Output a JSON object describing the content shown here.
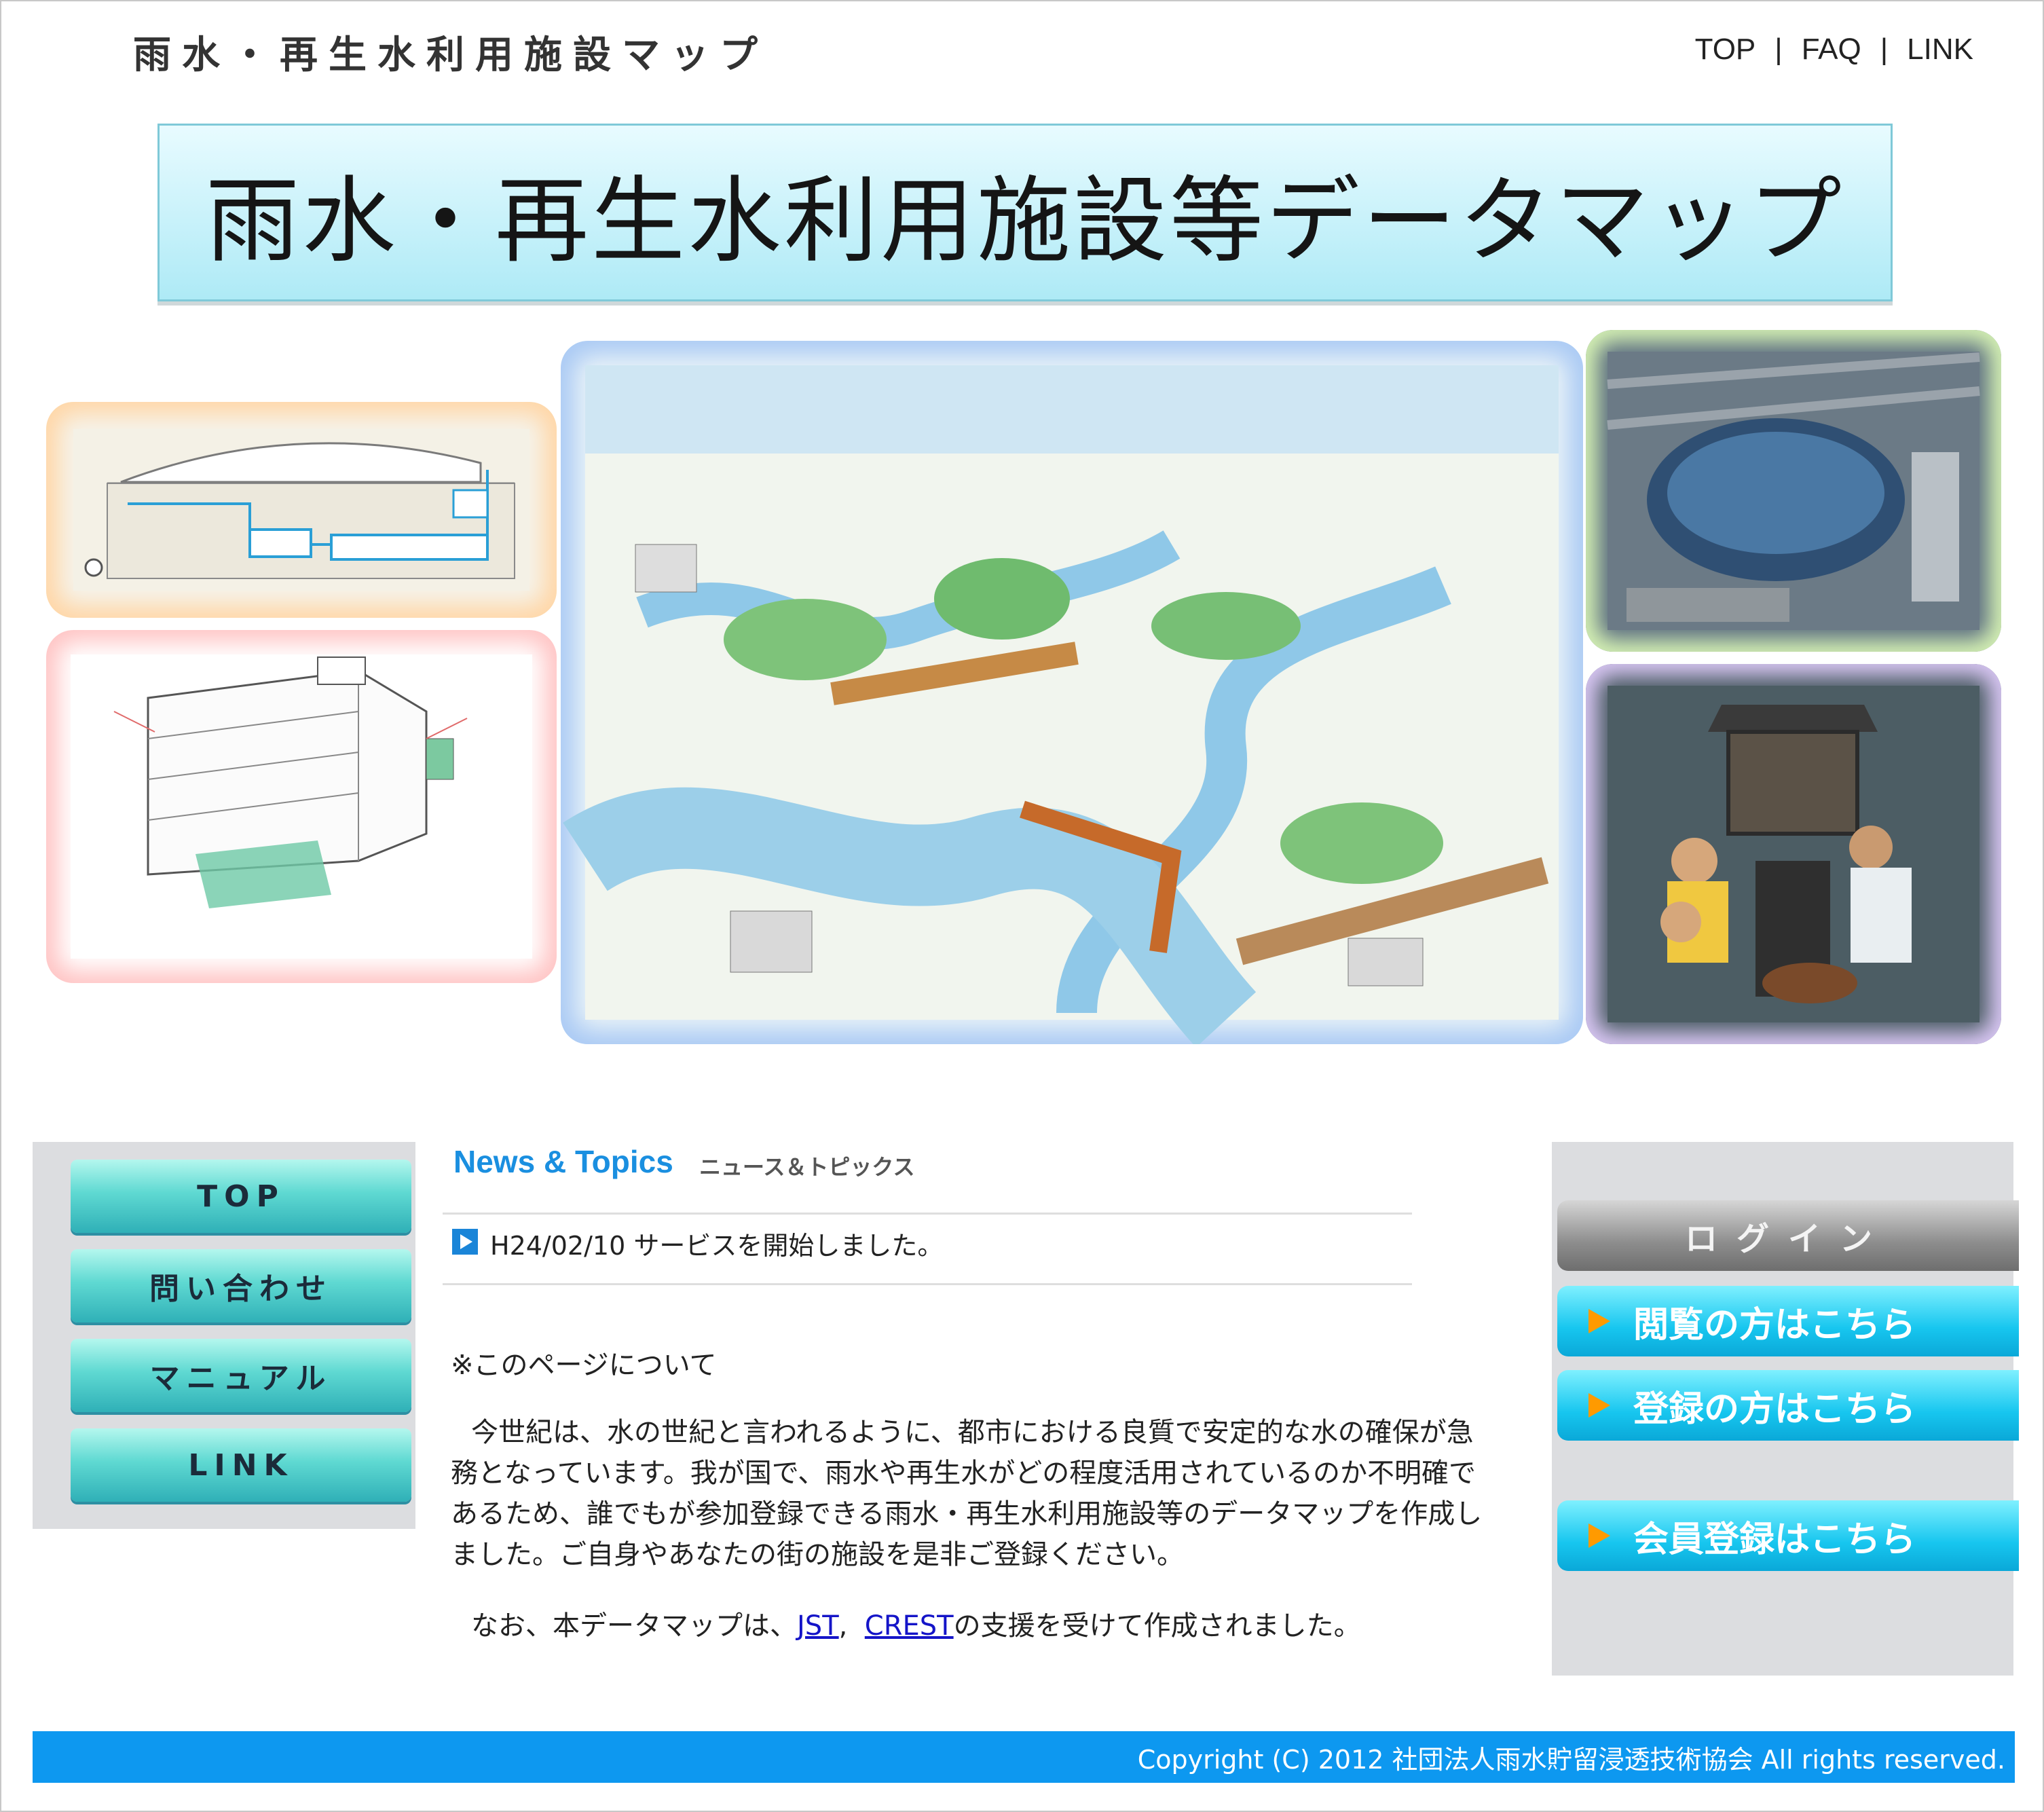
{
  "header": {
    "site_title": "雨水・再生水利用施設マップ",
    "nav": [
      "TOP",
      "FAQ",
      "LINK"
    ]
  },
  "banner": {
    "title": "雨水・再生水利用施設等データマップ"
  },
  "hero": {
    "images": [
      "facility-section-diagram",
      "building-diagram",
      "water-cycle-city-illustration",
      "stadium-aerial-photo",
      "children-at-rainwater-pump-photo"
    ]
  },
  "left_menu": {
    "items": [
      "TOP",
      "問い合わせ",
      "マニュアル",
      "LINK"
    ]
  },
  "news": {
    "title": "News & Topics",
    "subtitle": "ニュース＆トピックス",
    "items": [
      {
        "text": "H24/02/10 サービスを開始しました。"
      }
    ]
  },
  "about": {
    "heading": "※このページについて",
    "body": "今世紀は、水の世紀と言われるように、都市における良質で安定的な水の確保が急務となっています。我が国で、雨水や再生水がどの程度活用されているのか不明確であるため、誰でもが参加登録できる雨水・再生水利用施設等のデータマップを作成しました。ご自身やあなたの街の施設を是非ご登録ください。",
    "support_prefix": "なお、本データマップは、",
    "link_jst": "JST",
    "comma": ",",
    "link_crest": "CREST",
    "support_suffix": "の支援を受けて作成されました。"
  },
  "right_panel": {
    "login": "ログイン",
    "buttons": [
      "閲覧の方はこちら",
      "登録の方はこちら",
      "会員登録はこちら"
    ]
  },
  "footer": {
    "copyright": "Copyright (C) 2012 社団法人雨水貯留浸透技術協会 All rights reserved."
  },
  "colors": {
    "accent": "#0d98f0",
    "menu": "#5fd9d2",
    "login": "#17c6ef",
    "arrow": "#ff9a00"
  }
}
